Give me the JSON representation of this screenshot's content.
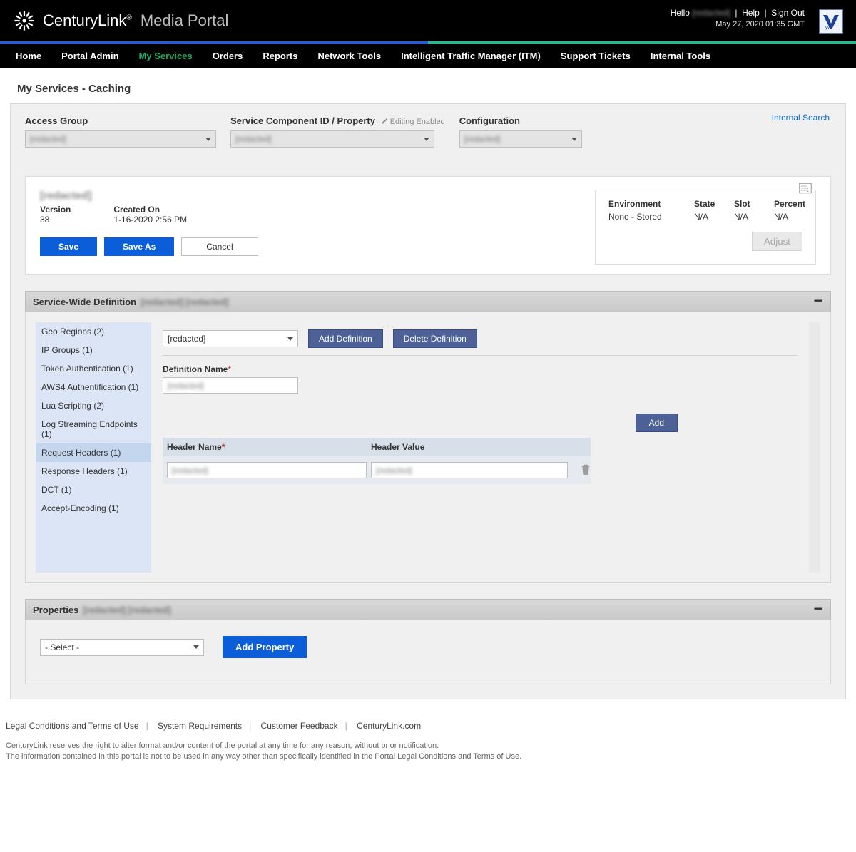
{
  "header": {
    "brand_main": "CenturyLink",
    "brand_sub": "Media Portal",
    "hello": "Hello",
    "user": "[redacted]",
    "help": "Help",
    "signout": "Sign Out",
    "timestamp": "May 27, 2020 01:35 GMT"
  },
  "nav": {
    "items": [
      "Home",
      "Portal Admin",
      "My Services",
      "Orders",
      "Reports",
      "Network Tools",
      "Intelligent Traffic Manager (ITM)",
      "Support Tickets",
      "Internal Tools"
    ],
    "active_index": 2
  },
  "page_title": "My Services - Caching",
  "selectors": {
    "access_group_label": "Access Group",
    "access_group_value": "[redacted]",
    "scid_label": "Service Component ID / Property",
    "editing_enabled": "Editing Enabled",
    "scid_value": "[redacted]",
    "config_label": "Configuration",
    "config_value": "[redacted]"
  },
  "internal_search": "Internal Search",
  "config_box": {
    "title": "[redacted]",
    "version_label": "Version",
    "version_value": "38",
    "created_label": "Created On",
    "created_value": "1-16-2020 2:56 PM",
    "save": "Save",
    "saveas": "Save As",
    "cancel": "Cancel",
    "env": {
      "environment_h": "Environment",
      "state_h": "State",
      "slot_h": "Slot",
      "percent_h": "Percent",
      "environment_v": "None - Stored",
      "state_v": "N/A",
      "slot_v": "N/A",
      "percent_v": "N/A",
      "adjust": "Adjust"
    }
  },
  "section_swd": {
    "title": "Service-Wide Definition",
    "title_extra": "[redacted]  [redacted]",
    "menu": [
      "Geo Regions (2)",
      "IP Groups (1)",
      "Token Authentication (1)",
      "AWS4 Authentification (1)",
      "Lua Scripting (2)",
      "Log Streaming Endpoints (1)",
      "Request Headers (1)",
      "Response Headers (1)",
      "DCT (1)",
      "Accept-Encoding (1)"
    ],
    "menu_active_index": 6,
    "def_select_value": "[redacted]",
    "add_def": "Add Definition",
    "del_def": "Delete Definition",
    "def_name_label": "Definition Name",
    "def_name_value": "[redacted]",
    "add_btn": "Add",
    "table": {
      "h_name": "Header Name",
      "h_value": "Header Value",
      "row_name": "[redacted]",
      "row_value": "[redacted]"
    }
  },
  "section_props": {
    "title": "Properties",
    "title_extra": "[redacted]  [redacted]",
    "select_value": "- Select -",
    "add_prop": "Add Property"
  },
  "footer": {
    "l1": "Legal Conditions and Terms of Use",
    "l2": "System Requirements",
    "l3": "Customer Feedback",
    "l4": "CenturyLink.com",
    "d1": "CenturyLink reserves the right to alter format and/or content of the portal at any time for any reason, without prior notification.",
    "d2": "The information contained in this portal is not to be used in any way other than specifically identified in the Portal Legal Conditions and Terms of Use."
  }
}
